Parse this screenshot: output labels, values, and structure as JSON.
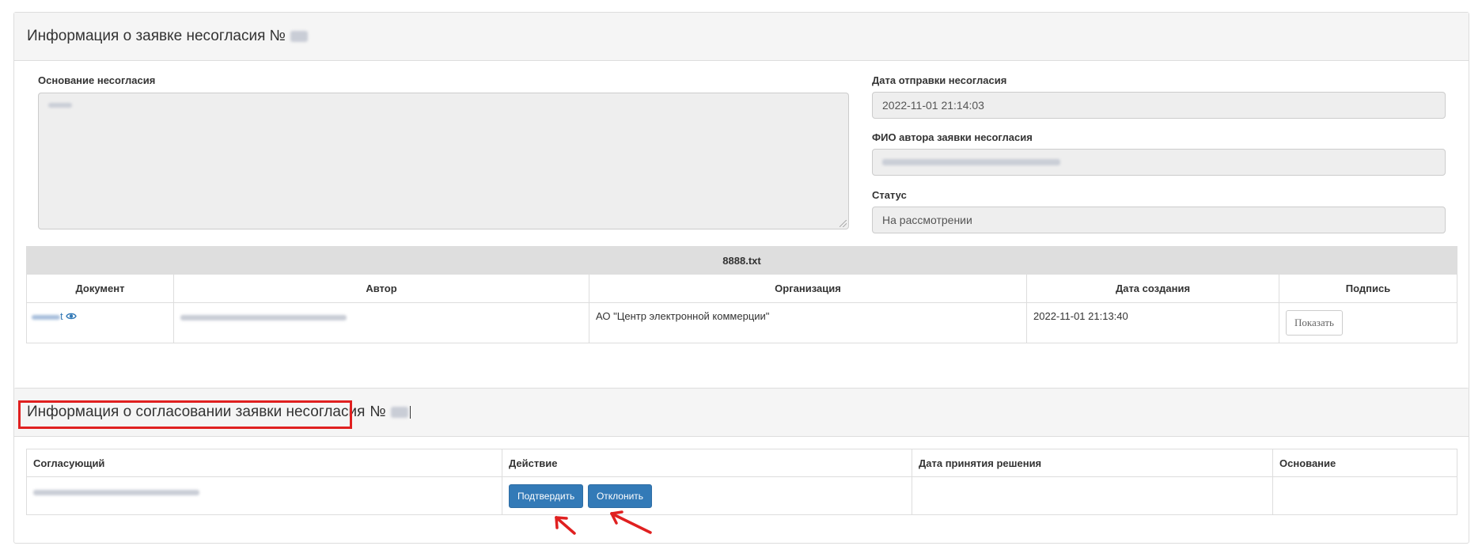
{
  "disagreement_panel": {
    "title": "Информация о заявке несогласия №",
    "reason_label": "Основание несогласия",
    "sent_date_label": "Дата отправки несогласия",
    "sent_date_value": "2022-11-01 21:14:03",
    "author_label": "ФИО автора заявки несогласия",
    "status_label": "Статус",
    "status_value": "На рассмотрении"
  },
  "files_table": {
    "caption": "8888.txt",
    "columns": [
      "Документ",
      "Автор",
      "Организация",
      "Дата создания",
      "Подпись"
    ],
    "rows": [
      {
        "document_suffix": "t",
        "organization": "АО \"Центр электронной коммерции\"",
        "created": "2022-11-01 21:13:40",
        "sign_button": "Показать"
      }
    ]
  },
  "approval_panel": {
    "title": "Информация о согласовании заявки несогласия",
    "number_sign": "№",
    "columns": [
      "Согласующий",
      "Действие",
      "Дата принятия решения",
      "Основание"
    ],
    "confirm_button": "Подтвердить",
    "reject_button": "Отклонить"
  },
  "colors": {
    "annotation_red": "#e02020",
    "primary_blue": "#337ab7"
  },
  "icons": {
    "view": "eye-icon"
  }
}
